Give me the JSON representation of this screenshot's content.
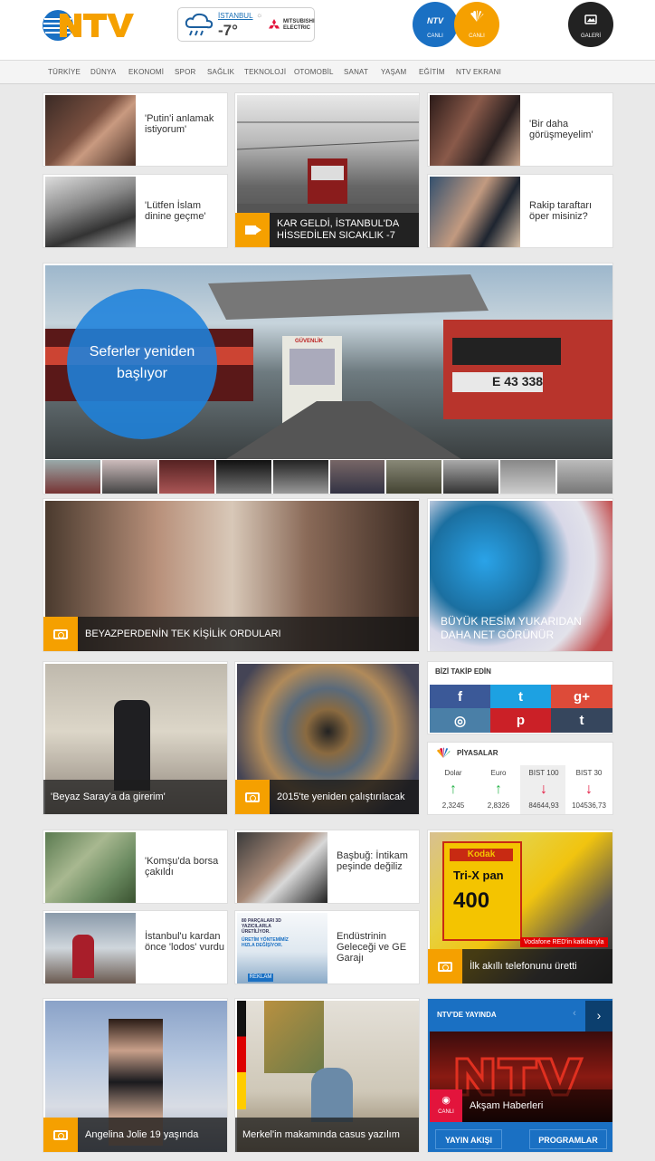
{
  "header": {
    "logo_text": "NTV",
    "weather": {
      "city": "İSTANBUL",
      "temp": "-7°",
      "sponsor": "MITSUBISHI ELECTRIC"
    },
    "live_ntv": {
      "name": "NTV",
      "label": "CANLI"
    },
    "live_cnbc": {
      "label": "CANLI"
    },
    "gallery": {
      "label": "GALERİ"
    }
  },
  "nav": [
    "TÜRKİYE",
    "DÜNYA",
    "EKONOMİ",
    "SPOR",
    "SAĞLIK",
    "TEKNOLOJİ",
    "OTOMOBİL",
    "SANAT",
    "YAŞAM",
    "EĞİTİM",
    "NTV EKRANI"
  ],
  "row1": {
    "q1": "'Putin'i anlamak istiyorum'",
    "q2": "'Lütfen İslam dinine geçme'",
    "featured": "KAR GELDİ, İSTANBUL'DA HİSSEDİLEN SICAKLIK -7",
    "q3": "'Bir daha görüşmeyelim'",
    "q4": "Rakip taraftarı öper misiniz?"
  },
  "hero": {
    "title": "Seferler yeniden başlıyor",
    "train_number": "E 43 338",
    "booth_sign": "GÜVENLİK"
  },
  "row2": {
    "big": "BEYAZPERDENİN TEK KİŞİLİK ORDULARI",
    "side": "BÜYÜK RESİM YUKARIDAN DAHA NET GÖRÜNÜR"
  },
  "row3": {
    "left": "'Beyaz Saray'a da girerim'",
    "mid": "2015'te yeniden çalıştırılacak"
  },
  "follow": {
    "title": "BİZİ TAKİP EDİN",
    "icons": [
      "facebook-icon",
      "twitter-icon",
      "googleplus-icon",
      "instagram-icon",
      "pinterest-icon",
      "tumblr-icon"
    ],
    "glyphs": [
      "f",
      "t",
      "g+",
      "◎",
      "p",
      "t"
    ]
  },
  "markets": {
    "title": "PİYASALAR",
    "items": [
      {
        "name": "Dolar",
        "dir": "up",
        "value": "2,3245"
      },
      {
        "name": "Euro",
        "dir": "up",
        "value": "2,8326"
      },
      {
        "name": "BIST 100",
        "dir": "down",
        "value": "84644,93"
      },
      {
        "name": "BIST 30",
        "dir": "down",
        "value": "104536,73"
      }
    ],
    "colors": {
      "up": "#27b34a",
      "down": "#e3143c"
    }
  },
  "row4": {
    "a": "'Komşu'da borsa çakıldı",
    "b": "Başbuğ: İntikam peşinde değiliz",
    "c": "İstanbul'u kardan önce 'lodos' vurdu",
    "d": "Endüstrinin Geleceği ve GE Garajı",
    "ad_line1": "80 PARÇALARI 3D YAZICILARLA ÜRETİLİYOR.",
    "ad_line2": "ÜRETİM YÖNTEMİMİZ HIZLA DEĞİŞİYOR.",
    "ad_badge": "REKLAM",
    "phone": "İlk akıllı telefonunu üretti",
    "vodafone": "Vodafone RED'in katkılarıyla",
    "kodak": "Kodak",
    "film_name": "Tri-X pan",
    "film_speed": "400"
  },
  "row5": {
    "angelina": "Angelina Jolie 19 yaşında",
    "merkel": "Merkel'in makamında casus yazılım"
  },
  "tv": {
    "title": "NTV'DE YAYINDA",
    "live": "CANLI",
    "program": "Akşam Haberleri",
    "btn1": "YAYIN AKIŞI",
    "btn2": "PROGRAMLAR"
  },
  "colors": {
    "accent": "#f5a000",
    "ntv_blue": "#1a70c3",
    "nav_bg": "#f4f4f4",
    "facebook": "#3b5998",
    "twitter": "#1da1e2",
    "googleplus": "#dd4b39",
    "instagram": "#4a7fa7",
    "pinterest": "#cb2027",
    "tumblr": "#36465d"
  }
}
